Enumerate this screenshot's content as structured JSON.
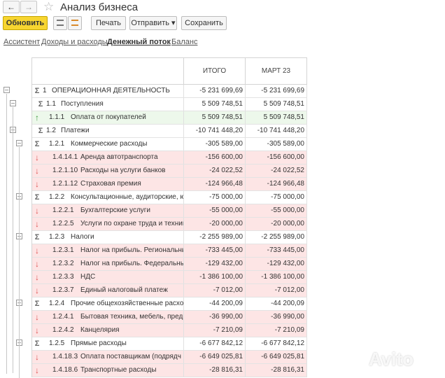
{
  "title": "Анализ бизнеса",
  "toolbar": {
    "refresh": "Обновить",
    "print": "Печать",
    "send": "Отправить",
    "save": "Сохранить"
  },
  "tabs": [
    "Ассистент",
    "Доходы и расходы",
    "Денежный поток",
    "Баланс"
  ],
  "active_tab": "Денежный поток",
  "columns": [
    "ИТОГО",
    "МАРТ 23"
  ],
  "rows": [
    {
      "code": "1",
      "label": "ОПЕРАЦИОННАЯ ДЕЯТЕЛЬНОСТЬ",
      "total": "-5 231 699,69",
      "mar": "-5 231 699,69"
    },
    {
      "code": "1.1",
      "label": "Поступления",
      "total": "5 509 748,51",
      "mar": "5 509 748,51"
    },
    {
      "code": "1.1.1",
      "label": "Оплата от покупателей",
      "total": "5 509 748,51",
      "mar": "5 509 748,51"
    },
    {
      "code": "1.2",
      "label": "Платежи",
      "total": "-10 741 448,20",
      "mar": "-10 741 448,20"
    },
    {
      "code": "1.2.1",
      "label": "Коммерческие расходы",
      "total": "-305 589,00",
      "mar": "-305 589,00"
    },
    {
      "code": "1.4.14.1",
      "label": "Аренда автотранспорта",
      "total": "-156 600,00",
      "mar": "-156 600,00"
    },
    {
      "code": "1.2.1.10",
      "label": "Расходы на услуги банков",
      "total": "-24 022,52",
      "mar": "-24 022,52"
    },
    {
      "code": "1.2.1.12",
      "label": "Страховая премия",
      "total": "-124 966,48",
      "mar": "-124 966,48"
    },
    {
      "code": "1.2.2",
      "label": "Консультационные, аудиторские, ю",
      "total": "-75 000,00",
      "mar": "-75 000,00"
    },
    {
      "code": "1.2.2.1",
      "label": "Бухгалтерские услуги",
      "total": "-55 000,00",
      "mar": "-55 000,00"
    },
    {
      "code": "1.2.2.5",
      "label": "Услуги по охране труда и техник",
      "total": "-20 000,00",
      "mar": "-20 000,00"
    },
    {
      "code": "1.2.3",
      "label": "Налоги",
      "total": "-2 255 989,00",
      "mar": "-2 255 989,00"
    },
    {
      "code": "1.2.3.1",
      "label": "Налог на прибыль. Региональны",
      "total": "-733 445,00",
      "mar": "-733 445,00"
    },
    {
      "code": "1.2.3.2",
      "label": "Налог на прибыль. Федеральны",
      "total": "-129 432,00",
      "mar": "-129 432,00"
    },
    {
      "code": "1.2.3.3",
      "label": "НДС",
      "total": "-1 386 100,00",
      "mar": "-1 386 100,00"
    },
    {
      "code": "1.2.3.7",
      "label": "Единый налоговый платеж",
      "total": "-7 012,00",
      "mar": "-7 012,00"
    },
    {
      "code": "1.2.4",
      "label": "Прочие общехозяйственные расход",
      "total": "-44 200,09",
      "mar": "-44 200,09"
    },
    {
      "code": "1.2.4.1",
      "label": "Бытовая техника, мебель, предм",
      "total": "-36 990,00",
      "mar": "-36 990,00"
    },
    {
      "code": "1.2.4.2",
      "label": "Канцелярия",
      "total": "-7 210,09",
      "mar": "-7 210,09"
    },
    {
      "code": "1.2.5",
      "label": "Прямые расходы",
      "total": "-6 677 842,12",
      "mar": "-6 677 842,12"
    },
    {
      "code": "1.4.18.3",
      "label": "Оплата поставщикам (подрядч",
      "total": "-6 649 025,81",
      "mar": "-6 649 025,81"
    },
    {
      "code": "1.4.18.6",
      "label": "Транспортные расходы",
      "total": "-28 816,31",
      "mar": "-28 816,31"
    }
  ],
  "watermark": "Avito"
}
